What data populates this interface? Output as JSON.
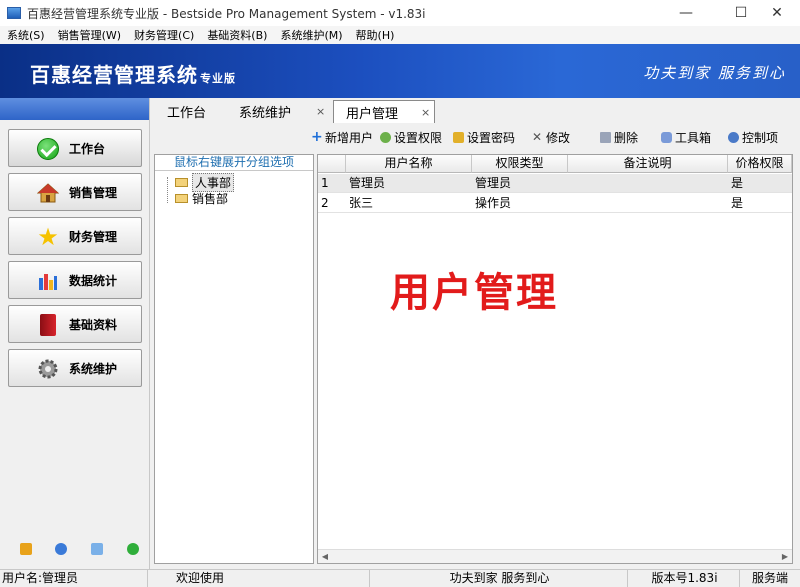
{
  "window": {
    "title": "百惠经营管理系统专业版 - Bestside Pro Management System - v1.83i",
    "minimize": "—",
    "maximize": "☐",
    "close": "✕"
  },
  "menu": [
    "系统(S)",
    "销售管理(W)",
    "财务管理(C)",
    "基础资料(B)",
    "系统维护(M)",
    "帮助(H)"
  ],
  "banner": {
    "brand": "百惠经营管理系统",
    "brand_sub": "专业版",
    "slogan": "功夫到家 服务到心"
  },
  "nav": [
    {
      "label": "工作台",
      "icon": "check-circle-icon",
      "active": true
    },
    {
      "label": "销售管理",
      "icon": "house-icon"
    },
    {
      "label": "财务管理",
      "icon": "star-icon"
    },
    {
      "label": "数据统计",
      "icon": "bar-chart-icon"
    },
    {
      "label": "基础资料",
      "icon": "book-icon"
    },
    {
      "label": "系统维护",
      "icon": "gear-icon"
    }
  ],
  "bottom_icons": [
    "key-icon",
    "clock-icon",
    "search-icon",
    "refresh-icon"
  ],
  "tabs": [
    {
      "label": "工作台"
    },
    {
      "label": "系统维护",
      "close": "×"
    },
    {
      "label": "用户管理",
      "close": "×",
      "active": true
    }
  ],
  "toolbar": [
    {
      "label": "新增用户",
      "icon": "plus-icon"
    },
    {
      "label": "设置权限",
      "icon": "permission-icon"
    },
    {
      "label": "设置密码",
      "icon": "lock-icon"
    },
    {
      "label": "修改",
      "icon": "edit-icon"
    },
    {
      "label": "删除",
      "icon": "trash-icon"
    },
    {
      "label": "工具箱",
      "icon": "toolbox-icon"
    },
    {
      "label": "控制项",
      "icon": "control-icon"
    }
  ],
  "tree": {
    "header": "鼠标右键展开分组选项",
    "items": [
      "人事部",
      "销售部"
    ]
  },
  "grid": {
    "columns": [
      "用户名称",
      "权限类型",
      "备注说明",
      "价格权限"
    ],
    "rows": [
      {
        "index": "1",
        "name": "管理员",
        "type": "管理员",
        "note": "",
        "price": "是"
      },
      {
        "index": "2",
        "name": "张三",
        "type": "操作员",
        "note": "",
        "price": "是"
      }
    ],
    "watermark": "用户管理"
  },
  "status": {
    "user": "用户名:管理员",
    "welcome": "欢迎使用",
    "slogan": "功夫到家 服务到心",
    "version": "版本号1.83i",
    "mode": "服务端"
  },
  "colors": {
    "banner": "#1c4fbf",
    "watermark": "#e21b1b",
    "tree_header": "#1f6fb0"
  }
}
